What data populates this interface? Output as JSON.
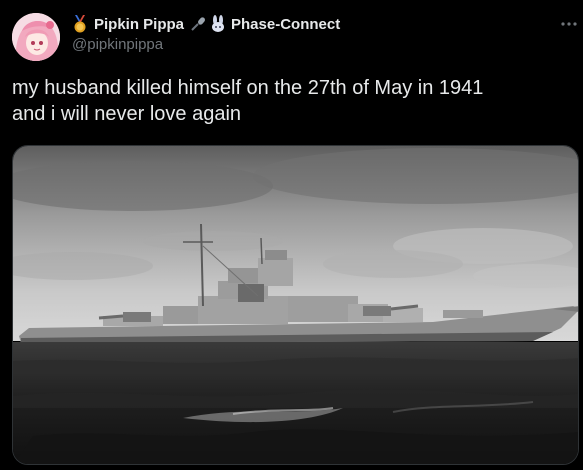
{
  "author": {
    "display_name": "Pipkin Pippa",
    "handle": "@pipkinpippa",
    "org_name": "Phase-Connect",
    "avatar_icon": "avatar-pink-hair",
    "medal_icon": "medal-icon",
    "org_icons": [
      "microphone-icon",
      "rabbit-icon"
    ]
  },
  "menu_icon": "more-horizontal-icon",
  "tweet": {
    "text_lines": [
      "my husband killed himself on the 27th of May in 1941",
      "and i will never love again"
    ]
  },
  "photo": {
    "subject": "black-and-white photograph of a battleship at sea"
  },
  "colors": {
    "background": "#000000",
    "text_primary": "#e7e9ea",
    "text_secondary": "#71767b",
    "border": "#2f3336",
    "medal_gold": "#e0a020"
  }
}
